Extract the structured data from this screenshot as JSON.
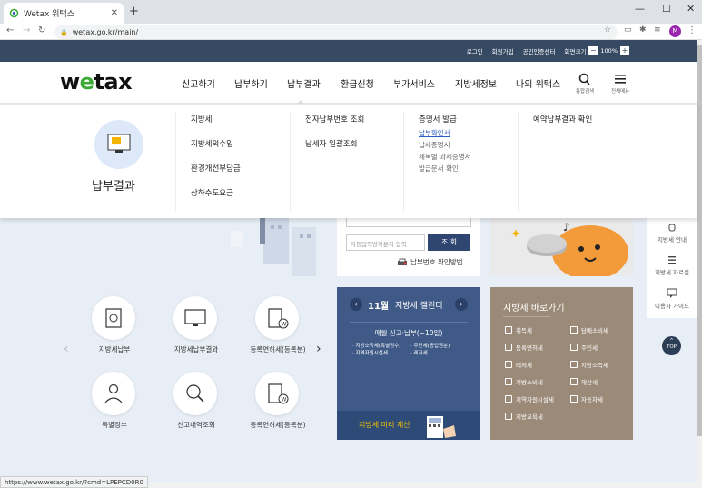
{
  "browser": {
    "tab_title": "Wetax 위택스",
    "url": "wetax.go.kr/main/",
    "profile_initial": "M",
    "status_url": "https://www.wetax.go.kr/?cmd=LPEPCD0R0"
  },
  "util": {
    "login": "로그인",
    "join": "회원가입",
    "cert": "공인인증센터",
    "zoom_label": "화면크기",
    "zoom_value": "100%",
    "zoom_minus": "−",
    "zoom_plus": "+"
  },
  "header": {
    "logo_pre": "w",
    "logo_e": "e",
    "logo_post": "tax",
    "gnb": [
      "신고하기",
      "납부하기",
      "납부결과",
      "환급신청",
      "부가서비스",
      "지방세정보",
      "나의 위택스"
    ],
    "search_label": "통합검색",
    "menu_label": "전체메뉴"
  },
  "mega": {
    "title": "납부결과",
    "col1": [
      "지방세",
      "지방세외수입",
      "환경개선부담금",
      "상하수도요금"
    ],
    "col2": [
      "전자납부번호 조회",
      "납세자 일괄조회"
    ],
    "col3_title": "증명서 발급",
    "col3_items": [
      "납부확인서",
      "납세증명서",
      "세목별 과세증명서",
      "발급문서 확인"
    ],
    "col4": [
      "예약납부결과 확인"
    ]
  },
  "search": {
    "captcha_placeholder": "자동입력방지문자 입력",
    "search_button": "조 회",
    "payno_link": "납부번호 확인방법"
  },
  "quick": {
    "row1": [
      "지방세납부",
      "지방세납부결과",
      "등록면허세(등록분)"
    ],
    "row2": [
      "특별징수",
      "신고내역조회",
      "등록면허세(등록분)"
    ],
    "prev": "‹",
    "next": "›"
  },
  "calendar": {
    "month": "11월",
    "title": "지방세 캘린더",
    "subtitle": "매월 신고·납부(~10일)",
    "items_left": [
      "· 지방소득세(특별징수)",
      "· 지역자원시설세"
    ],
    "items_right": [
      "· 주민세(종업원분)",
      "· 레저세"
    ],
    "footer": "지방세 미리 계산"
  },
  "direct": {
    "title": "지방세 바로가기",
    "left": [
      "취득세",
      "등록면허세",
      "레저세",
      "지방소비세",
      "지역자원시설세",
      "지방교육세"
    ],
    "right": [
      "담배소비세",
      "주민세",
      "지방소득세",
      "재산세",
      "자동차세"
    ]
  },
  "rside": {
    "items": [
      "지방세 안내",
      "지방세 자료실",
      "이용자 가이드"
    ],
    "top": "TOP"
  },
  "colors": {
    "navy": "#374a63",
    "green": "#3aaa35",
    "calendar_bg": "#3f5a86",
    "direct_bg": "#9c8a78"
  }
}
